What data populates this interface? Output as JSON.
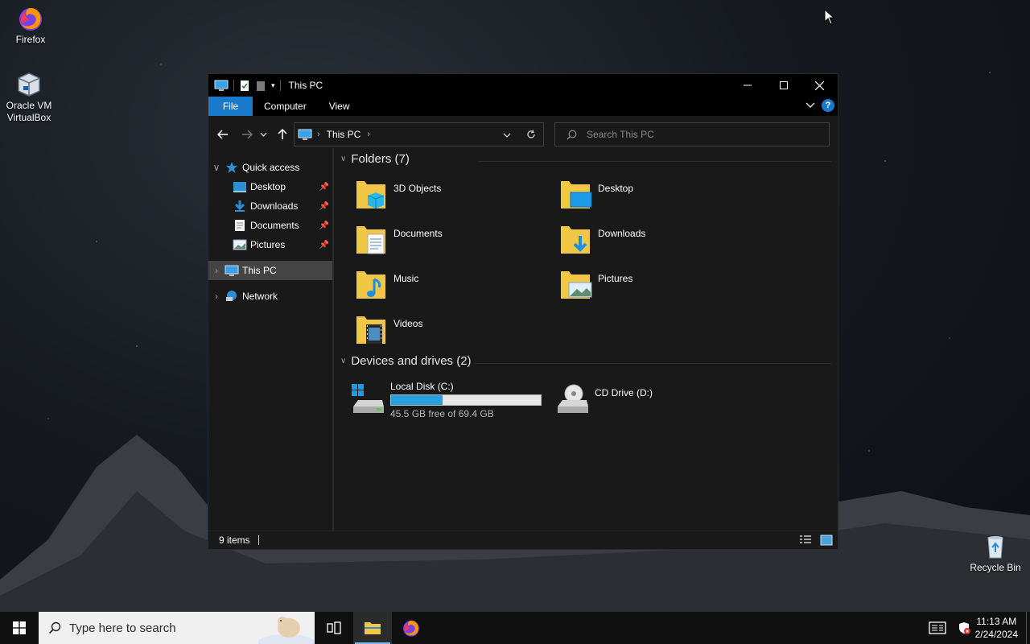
{
  "desktop": {
    "icons": [
      {
        "label": "Firefox"
      },
      {
        "label": "Oracle VM VirtualBox"
      },
      {
        "label": "Recycle Bin"
      }
    ]
  },
  "window": {
    "title": "This PC",
    "controls": {
      "minimize": "minimize",
      "maximize": "maximize",
      "close": "close"
    },
    "ribbon_tabs": [
      "File",
      "Computer",
      "View"
    ],
    "help": "?",
    "address": {
      "location": "This PC"
    },
    "search": {
      "placeholder": "Search This PC"
    },
    "nav": {
      "quick_access": "Quick access",
      "quick_items": [
        "Desktop",
        "Downloads",
        "Documents",
        "Pictures"
      ],
      "this_pc": "This PC",
      "network": "Network"
    },
    "folders_header": "Folders (7)",
    "folders": [
      "3D Objects",
      "Desktop",
      "Documents",
      "Downloads",
      "Music",
      "Pictures",
      "Videos"
    ],
    "drives_header": "Devices and drives (2)",
    "drives": [
      {
        "name": "Local Disk (C:)",
        "free": "45.5 GB free of 69.4 GB",
        "used_fraction": 0.344
      },
      {
        "name": "CD Drive (D:)"
      }
    ],
    "status": "9 items"
  },
  "taskbar": {
    "search_placeholder": "Type here to search",
    "time": "11:13 AM",
    "date": "2/24/2024"
  },
  "colors": {
    "accent": "#1979ca",
    "drive_bar": "#26a0da",
    "folder": "#f3c746"
  }
}
